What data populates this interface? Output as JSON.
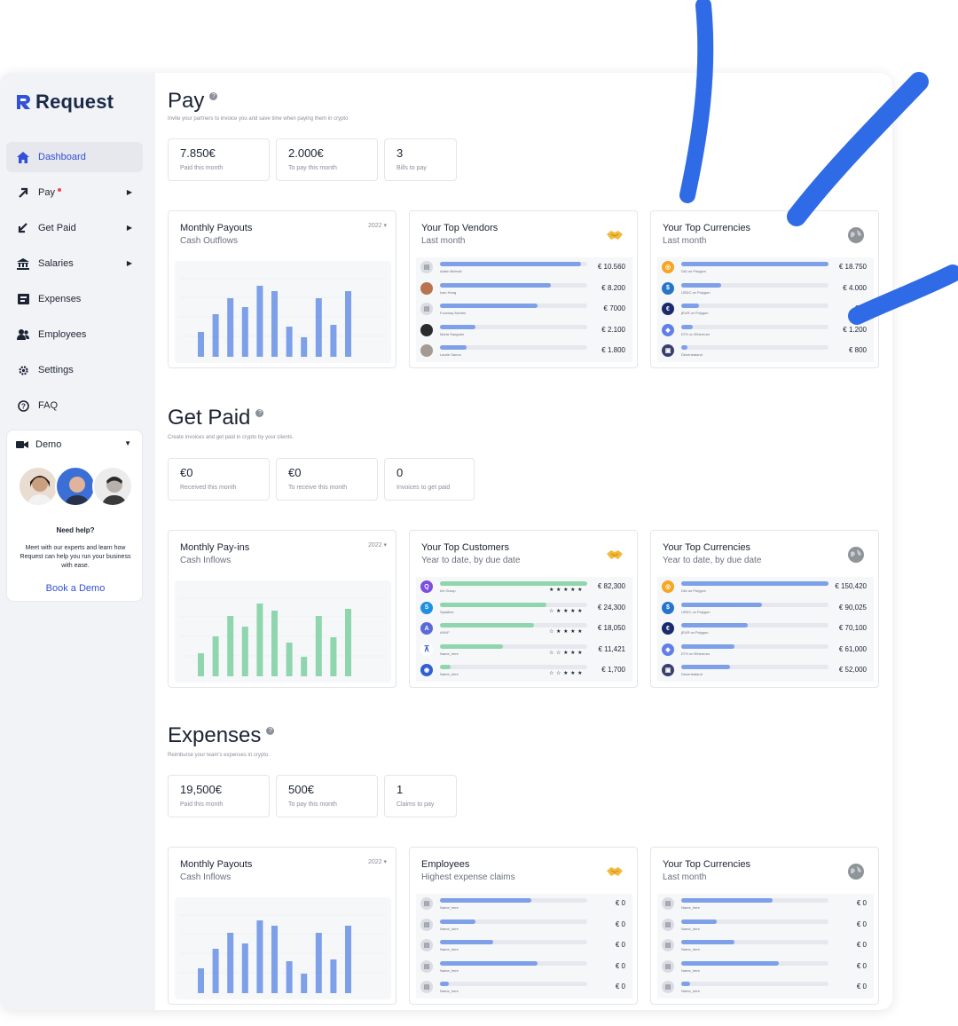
{
  "brand": {
    "name": "Request"
  },
  "sidebar": {
    "items": [
      {
        "label": "Dashboard",
        "icon": "home-icon",
        "active": true,
        "caret": false,
        "dot": false
      },
      {
        "label": "Pay",
        "icon": "arrow-up-right-icon",
        "active": false,
        "caret": true,
        "dot": true
      },
      {
        "label": "Get Paid",
        "icon": "arrow-down-left-icon",
        "active": false,
        "caret": true,
        "dot": false
      },
      {
        "label": "Salaries",
        "icon": "bank-icon",
        "active": false,
        "caret": true,
        "dot": false
      },
      {
        "label": "Expenses",
        "icon": "receipt-icon",
        "active": false,
        "caret": false,
        "dot": false
      },
      {
        "label": "Employees",
        "icon": "users-icon",
        "active": false,
        "caret": false,
        "dot": false
      },
      {
        "label": "Settings",
        "icon": "gear-icon",
        "active": false,
        "caret": false,
        "dot": false
      },
      {
        "label": "FAQ",
        "icon": "question-icon",
        "active": false,
        "caret": false,
        "dot": false
      }
    ],
    "demo": {
      "label": "Demo",
      "help_title": "Need help?",
      "help_text": "Meet with our experts and learn how Request can help you run your business with ease.",
      "book_label": "Book a Demo"
    }
  },
  "sections": {
    "pay": {
      "title": "Pay",
      "subtitle": "Invite your partners to invoice you and save time when paying them in crypto",
      "stats": [
        {
          "value": "7.850€",
          "label": "Paid this month"
        },
        {
          "value": "2.000€",
          "label": "To pay this month"
        },
        {
          "value": "3",
          "label": "Bills to pay"
        }
      ],
      "chart_card": {
        "title": "Monthly Payouts",
        "subtitle": "Cash Outflows",
        "year": "2022 ▾"
      },
      "vendors_card": {
        "title": "Your Top Vendors",
        "subtitle": "Last month",
        "rows": [
          {
            "name": "Adam Belecki",
            "amount": "€ 10.560",
            "share": 0.96
          },
          {
            "name": "Ivan Hong",
            "amount": "€ 8.200",
            "share": 0.75
          },
          {
            "name": "Fourway Movies",
            "amount": "€ 7000",
            "share": 0.66
          },
          {
            "name": "Maria Saugrain",
            "amount": "€ 2.100",
            "share": 0.24
          },
          {
            "name": "Laurie Sanon",
            "amount": "€ 1.800",
            "share": 0.18
          }
        ]
      },
      "currencies_card": {
        "title": "Your Top Currencies",
        "subtitle": "Last month",
        "rows": [
          {
            "name": "DAI on Polygon",
            "amount": "€ 18.750",
            "share": 1.0
          },
          {
            "name": "USDC on Polygon",
            "amount": "€ 4.000",
            "share": 0.27
          },
          {
            "name": "jEUR on Polygon",
            "amount": "€ 3.",
            "share": 0.12
          },
          {
            "name": "ETH on Ethereum",
            "amount": "€ 1.200",
            "share": 0.08
          },
          {
            "name": "Decentraland",
            "amount": "€ 800",
            "share": 0.04
          }
        ]
      }
    },
    "getpaid": {
      "title": "Get Paid",
      "subtitle": "Create invoices and get paid in crypto by your clients.",
      "stats": [
        {
          "value": "€0",
          "label": "Received this month"
        },
        {
          "value": "€0",
          "label": "To receive this month"
        },
        {
          "value": "0",
          "label": "Invoices to get paid"
        }
      ],
      "chart_card": {
        "title": "Monthly Pay-ins",
        "subtitle": "Cash Inflows",
        "year": "2022 ▾"
      },
      "customers_card": {
        "title": "Your Top Customers",
        "subtitle": "Year to date, by due date",
        "rows": [
          {
            "name": "Irix Group",
            "amount": "€ 82,300",
            "share": 1.0,
            "stars": "★ ★ ★ ★ ★"
          },
          {
            "name": "Spadline",
            "amount": "€ 24,300",
            "share": 0.72,
            "stars": "☆ ★ ★ ★ ★"
          },
          {
            "name": "ANVF",
            "amount": "€ 18,050",
            "share": 0.64,
            "stars": "☆ ★ ★ ★ ★"
          },
          {
            "name": "Name_here",
            "amount": "€ 11,421",
            "share": 0.43,
            "stars": "☆ ☆ ★ ★ ★"
          },
          {
            "name": "Name_here",
            "amount": "€ 1,700",
            "share": 0.07,
            "stars": "☆ ☆ ★ ★ ★"
          }
        ]
      },
      "currencies_card": {
        "title": "Your Top Currencies",
        "subtitle": "Year to date, by due date",
        "rows": [
          {
            "name": "DAI on Polygon",
            "amount": "€ 150,420",
            "share": 1.0
          },
          {
            "name": "USDC on Polygon",
            "amount": "€ 90,025",
            "share": 0.55
          },
          {
            "name": "jEUR on Polygon",
            "amount": "€ 70,100",
            "share": 0.45
          },
          {
            "name": "ETH on Ethereum",
            "amount": "€ 61,000",
            "share": 0.36
          },
          {
            "name": "Decentraland",
            "amount": "€ 52,000",
            "share": 0.33
          }
        ]
      }
    },
    "expenses": {
      "title": "Expenses",
      "subtitle": "Reimburse your team's expenses in crypto.",
      "stats": [
        {
          "value": "19,500€",
          "label": "Paid this month"
        },
        {
          "value": "500€",
          "label": "To pay this month"
        },
        {
          "value": "1",
          "label": "Claims to pay"
        }
      ],
      "chart_card": {
        "title": "Monthly Payouts",
        "subtitle": "Cash Inflows",
        "year": "2022 ▾"
      },
      "employees_card": {
        "title": "Employees",
        "subtitle": "Highest expense claims",
        "rows": [
          {
            "name": "Name_here",
            "amount": "€ 0",
            "share": 0.62
          },
          {
            "name": "Name_here",
            "amount": "€ 0",
            "share": 0.24
          },
          {
            "name": "Name_here",
            "amount": "€ 0",
            "share": 0.36
          },
          {
            "name": "Name_here",
            "amount": "€ 0",
            "share": 0.66
          },
          {
            "name": "Name_here",
            "amount": "€ 0",
            "share": 0.06
          }
        ]
      },
      "currencies_card": {
        "title": "Your Top Currencies",
        "subtitle": "Last month",
        "rows": [
          {
            "name": "Name_here",
            "amount": "€ 0",
            "share": 0.62
          },
          {
            "name": "Name_here",
            "amount": "€ 0",
            "share": 0.24
          },
          {
            "name": "Name_here",
            "amount": "€ 0",
            "share": 0.36
          },
          {
            "name": "Name_here",
            "amount": "€ 0",
            "share": 0.66
          },
          {
            "name": "Name_here",
            "amount": "€ 0",
            "share": 0.06
          }
        ]
      }
    }
  },
  "colors": {
    "accent": "#3250d8",
    "bar_blue": "#7da0e8",
    "bar_green": "#8fd6ae",
    "panel": "#f2f3f6",
    "marker": "#2f6be6"
  },
  "chart_data": [
    {
      "type": "bar",
      "categories": [],
      "values": [
        0.28,
        0.48,
        0.66,
        0.56,
        0.8,
        0.74,
        0.34,
        0.22,
        0.66,
        0.36,
        0.74
      ],
      "title": "Monthly Payouts",
      "ylim": [
        0,
        1
      ]
    },
    {
      "type": "bar",
      "categories": [],
      "values": [
        0.26,
        0.45,
        0.68,
        0.56,
        0.82,
        0.74,
        0.38,
        0.22,
        0.68,
        0.44,
        0.76
      ],
      "title": "Monthly Pay-ins",
      "ylim": [
        0,
        1
      ]
    },
    {
      "type": "bar",
      "categories": [],
      "values": [
        0.28,
        0.5,
        0.68,
        0.56,
        0.82,
        0.76,
        0.36,
        0.22,
        0.68,
        0.38,
        0.76
      ],
      "title": "Monthly Payouts",
      "ylim": [
        0,
        1
      ]
    }
  ]
}
